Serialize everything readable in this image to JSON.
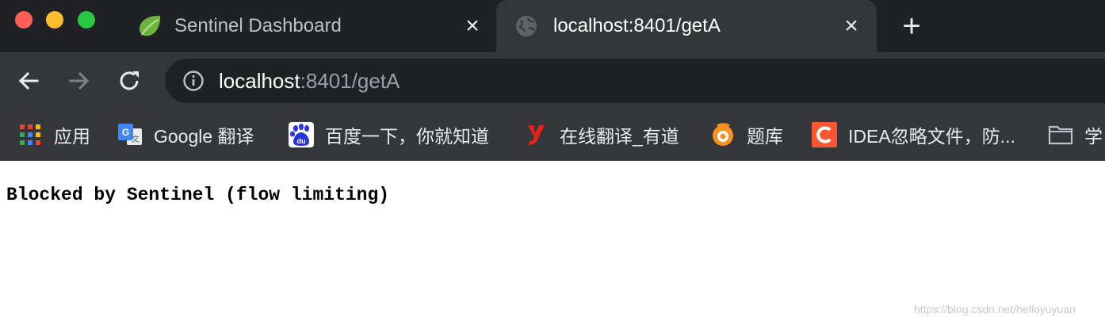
{
  "window": {
    "tabs": [
      {
        "title": "Sentinel Dashboard",
        "favicon": "spring-leaf-icon",
        "active": false
      },
      {
        "title": "localhost:8401/getA",
        "favicon": "globe-icon",
        "active": true
      }
    ],
    "new_tab_symbol": "+",
    "tab_close_symbol": "×"
  },
  "toolbar": {
    "url_host": "localhost",
    "url_rest": ":8401/getA"
  },
  "bookmarks": [
    {
      "label": "应用",
      "icon": "apps-grid-icon"
    },
    {
      "label": "Google 翻译",
      "icon": "google-translate-icon"
    },
    {
      "label": "百度一下，你就知道",
      "icon": "baidu-paw-icon"
    },
    {
      "label": "在线翻译_有道",
      "icon": "youdao-icon"
    },
    {
      "label": "题库",
      "icon": "tiku-icon"
    },
    {
      "label": "IDEA忽略文件，防...",
      "icon": "csdn-c-icon"
    },
    {
      "label": "学",
      "icon": "folder-icon"
    }
  ],
  "page": {
    "body_text": "Blocked by Sentinel (flow limiting)",
    "watermark": "https://blog.csdn.net/helloyuyuan"
  },
  "colors": {
    "tabstrip": "#202124",
    "toolbar": "#35363a",
    "omnibox": "#202124"
  }
}
